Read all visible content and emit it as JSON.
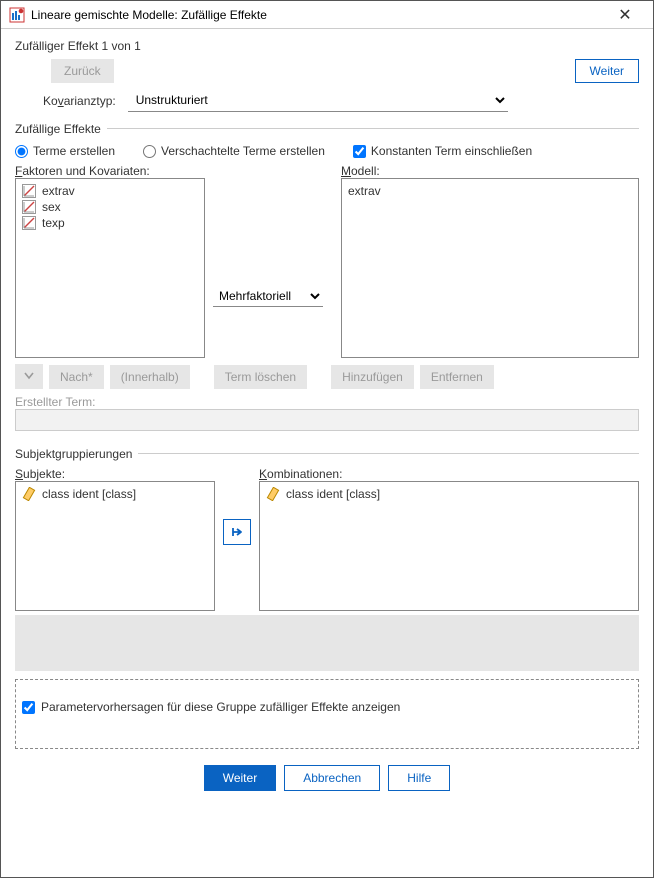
{
  "window": {
    "title": "Lineare gemischte Modelle: Zufällige Effekte"
  },
  "nav": {
    "counter": "Zufälliger Effekt 1 von 1",
    "back": "Zurück",
    "next": "Weiter"
  },
  "cov": {
    "label_pre": "Ko",
    "label_u": "v",
    "label_post": "arianztyp:",
    "value": "Unstrukturiert"
  },
  "effects": {
    "title": "Zufällige Effekte",
    "build": "Terme erstellen",
    "nested_pre": "Verschachtelte Terme erstelle",
    "nested_u": "n",
    "include_pre": "Konstanten Term ei",
    "include_u": "n",
    "include_post": "schließen"
  },
  "factors": {
    "label_u": "F",
    "label_post": "aktoren und Kovariaten:",
    "items": [
      "extrav",
      "sex",
      "texp"
    ]
  },
  "model": {
    "label_u": "M",
    "label_post": "odell:",
    "items": [
      "extrav"
    ]
  },
  "interaction": {
    "value": "Mehrfaktoriell"
  },
  "buttons": {
    "by": "Nach*",
    "within": "(Innerhalb)",
    "clear": "Term löschen",
    "add": "Hinzufügen",
    "remove": "Entfernen",
    "built_term": "Erstellter Term:"
  },
  "subjects": {
    "group_title": "Subjektgruppierungen",
    "label_u": "S",
    "label_post": "ubjekte:",
    "items": [
      "class ident [class]"
    ]
  },
  "combos": {
    "label_u": "K",
    "label_post": "ombinationen:",
    "items": [
      "class ident [class]"
    ]
  },
  "predictions": {
    "label": "Parametervorhersagen für diese Gruppe zufälliger Effekte anzeigen"
  },
  "footer": {
    "continue": "Weiter",
    "cancel": "Abbrechen",
    "help": "Hilfe"
  }
}
